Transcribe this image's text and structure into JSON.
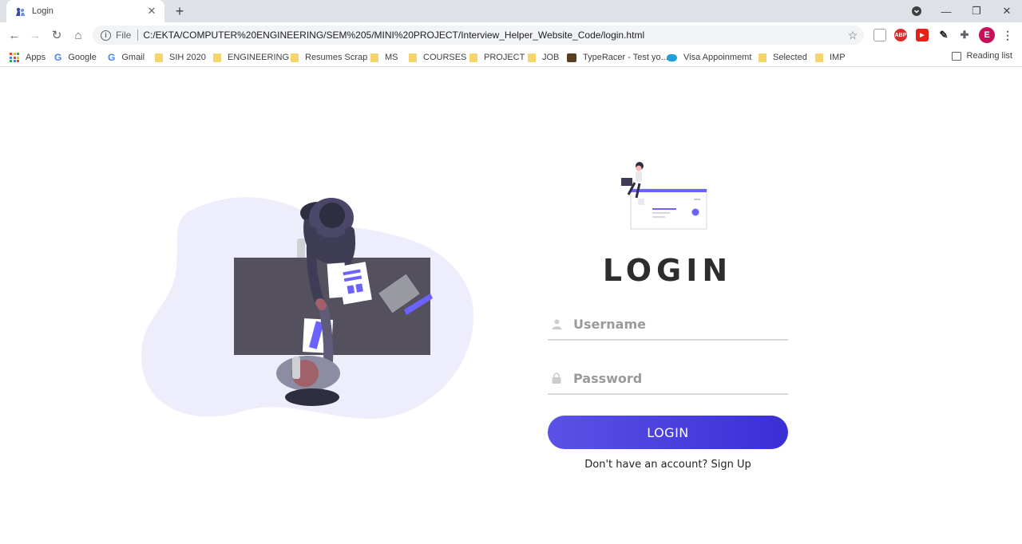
{
  "browser": {
    "tab_title": "Login",
    "new_tab": "+",
    "url_scheme": "File",
    "url": "C:/EKTA/COMPUTER%20ENGINEERING/SEM%205/MINI%20PROJECT/Interview_Helper_Website_Code/login.html",
    "bookmarks": [
      "Apps",
      "Google",
      "Gmail",
      "SIH 2020",
      "ENGINEERING",
      "Resumes Scrap",
      "MS",
      "COURSES",
      "PROJECT",
      "JOB",
      "TypeRacer - Test yo...",
      "Visa Appoinmemt",
      "Selected",
      "IMP"
    ],
    "reading_list": "Reading list",
    "profile_initial": "E",
    "ext_abp": "ABP"
  },
  "login": {
    "title": "LOGIN",
    "username_placeholder": "Username",
    "password_placeholder": "Password",
    "button_label": "LOGIN",
    "signup_prompt": "Don't have an account?",
    "signup_link": "Sign Up"
  },
  "colors": {
    "accent": "#4c44e0",
    "blob": "#eeedfb",
    "desk": "#54505e"
  }
}
